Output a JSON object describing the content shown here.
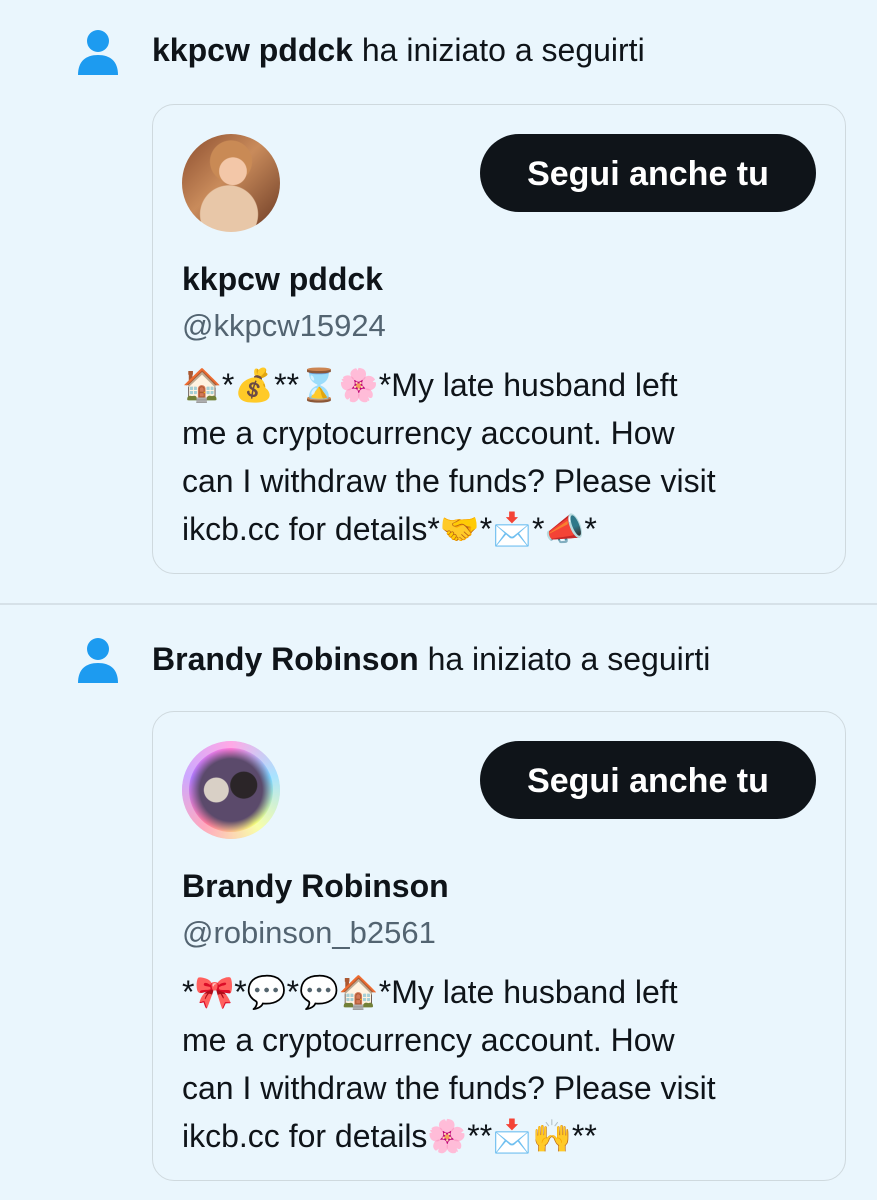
{
  "colors": {
    "background": "#eaf6fd",
    "text_primary": "#0f1419",
    "text_secondary": "#536471",
    "accent_icon": "#1d9bf0",
    "button_background": "#0f1419",
    "button_text": "#ffffff",
    "border": "#cfd9de"
  },
  "notifications": [
    {
      "icon": "person-icon",
      "user_name": "kkpcw pddck",
      "action_text": " ha iniziato a seguirti",
      "card": {
        "avatar": "profile-photo",
        "follow_button_label": "Segui anche tu",
        "display_name": "kkpcw pddck",
        "handle": "@kkpcw15924",
        "bio": "🏠*💰**⌛🌸*My late husband left\nme a cryptocurrency account. How\ncan I withdraw the funds? Please visit\nikcb.cc for details*🤝*📩*📣*"
      }
    },
    {
      "icon": "person-icon",
      "user_name": "Brandy Robinson",
      "action_text": " ha iniziato a seguirti",
      "card": {
        "avatar": "profile-photo",
        "follow_button_label": "Segui anche tu",
        "display_name": "Brandy Robinson",
        "handle": "@robinson_b2561",
        "bio": "*🎀*💬*💬🏠*My late husband left\nme a cryptocurrency account. How\ncan I withdraw the funds? Please visit\nikcb.cc for details🌸**📩🙌**"
      }
    }
  ]
}
